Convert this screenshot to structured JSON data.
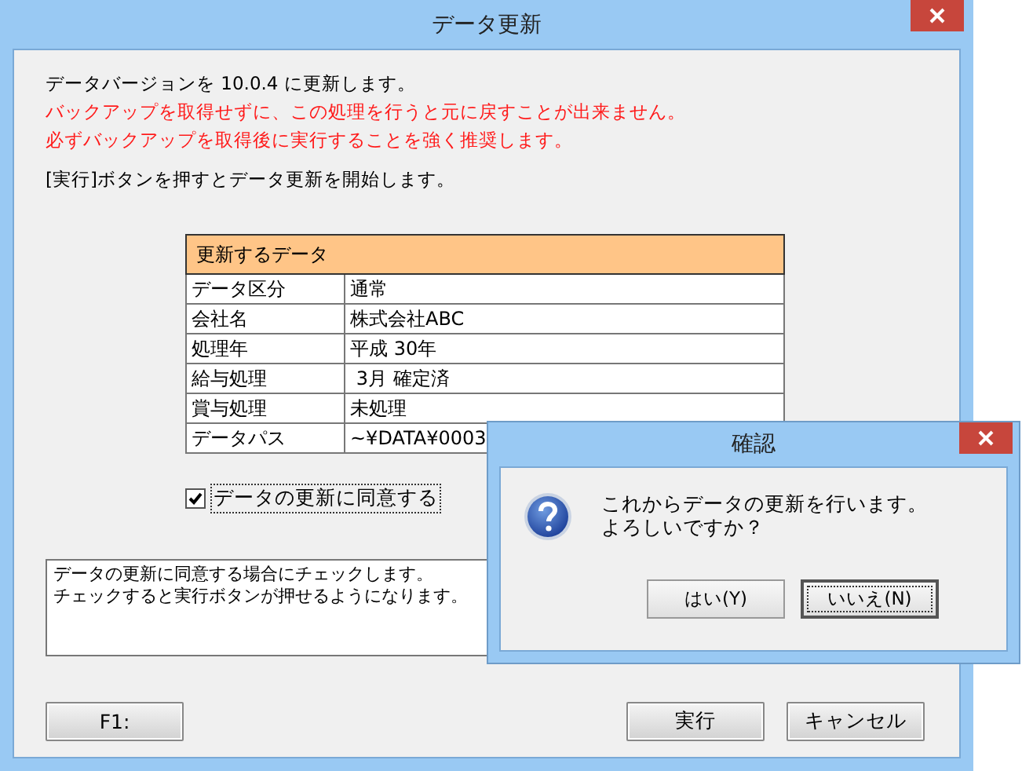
{
  "window": {
    "title": "データ更新"
  },
  "messages": [
    {
      "kind": "normal",
      "text": "データバージョンを 10.0.4 に更新します。"
    },
    {
      "kind": "warning",
      "text": "バックアップを取得せずに、この処理を行うと元に戻すことが出来ません。"
    },
    {
      "kind": "warning",
      "text": "必ずバックアップを取得後に実行することを強く推奨します。"
    }
  ],
  "instruction": "[実行]ボタンを押すとデータ更新を開始します。",
  "table": {
    "title": "更新するデータ",
    "rows": [
      {
        "label": "データ区分",
        "value": "通常"
      },
      {
        "label": "会社名",
        "value": "株式会社ABC"
      },
      {
        "label": "処理年",
        "value": "平成 30年"
      },
      {
        "label": "給与処理",
        "value": " 3月 確定済"
      },
      {
        "label": "賞与処理",
        "value": "未処理"
      },
      {
        "label": "データパス",
        "value": "~¥DATA¥0003"
      }
    ]
  },
  "agree_checkbox": {
    "label": "データの更新に同意する",
    "checked": true
  },
  "help_text": [
    "データの更新に同意する場合にチェックします。",
    "チェックすると実行ボタンが押せるようになります。"
  ],
  "buttons": {
    "function_key": "F1:",
    "actions": [
      "実行",
      "キャンセル"
    ]
  },
  "dialog": {
    "title": "確認",
    "message": [
      "これからデータの更新を行います。",
      "よろしいですか？"
    ],
    "buttons": [
      {
        "label": "はい(Y)",
        "focused": false
      },
      {
        "label": "いいえ(N)",
        "focused": true
      }
    ]
  }
}
